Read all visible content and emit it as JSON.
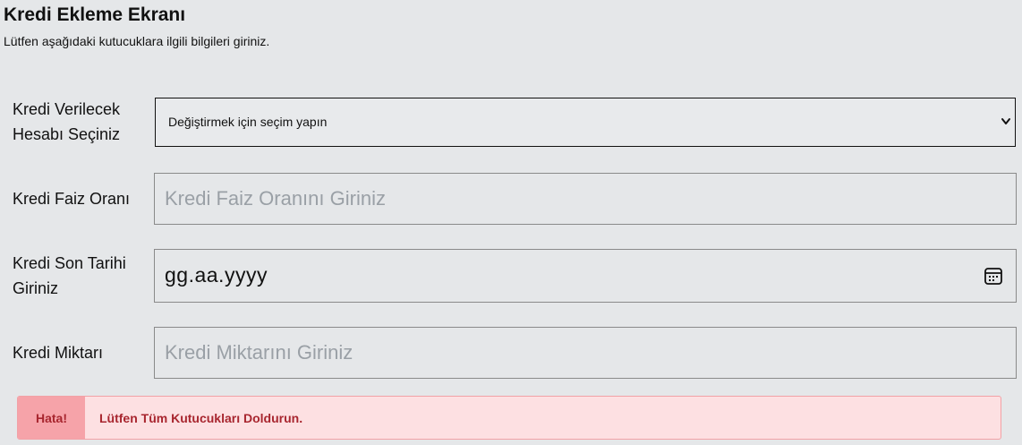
{
  "header": {
    "title": "Kredi Ekleme Ekranı",
    "subtitle": "Lütfen aşağıdaki kutucuklara ilgili bilgileri giriniz."
  },
  "form": {
    "account": {
      "label_line1": "Kredi Verilecek",
      "label_line2": "Hesabı Seçiniz",
      "selected": "Değiştirmek için seçim yapın"
    },
    "interest": {
      "label": "Kredi Faiz Oranı",
      "placeholder": "Kredi Faiz Oranını Giriniz"
    },
    "due_date": {
      "label_line1": "Kredi Son Tarihi",
      "label_line2": "Giriniz",
      "value": "gg.aa.yyyy"
    },
    "amount": {
      "label": "Kredi Miktarı",
      "placeholder": "Kredi Miktarını Giriniz"
    }
  },
  "alert": {
    "tag": "Hata!",
    "message": "Lütfen Tüm Kutucukları Doldurun.",
    "colors": {
      "background": "#fde0e2",
      "tag": "#f6a3a9",
      "text": "#a8262f"
    }
  },
  "icons": {
    "select": "chevron-down-icon",
    "date": "calendar-icon"
  }
}
